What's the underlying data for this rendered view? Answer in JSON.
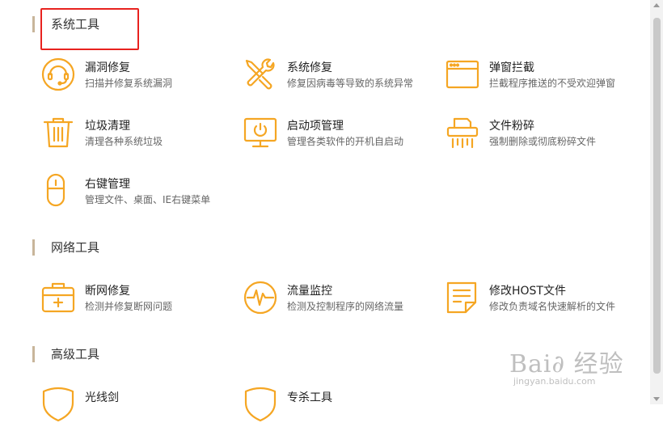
{
  "sections": [
    {
      "title": "系统工具"
    },
    {
      "title": "网络工具"
    },
    {
      "title": "高级工具"
    }
  ],
  "tools": {
    "loophole_repair": {
      "name": "漏洞修复",
      "desc": "扫描并修复系统漏洞",
      "icon": "shield-headset-icon"
    },
    "system_repair": {
      "name": "系统修复",
      "desc": "修复因病毒等导致的系统异常",
      "icon": "wrench-screwdriver-icon"
    },
    "popup_block": {
      "name": "弹窗拦截",
      "desc": "拦截程序推送的不受欢迎弹窗",
      "icon": "window-icon"
    },
    "junk_clean": {
      "name": "垃圾清理",
      "desc": "清理各种系统垃圾",
      "icon": "trash-icon"
    },
    "startup_manage": {
      "name": "启动项管理",
      "desc": "管理各类软件的开机自启动",
      "icon": "monitor-power-icon"
    },
    "file_shred": {
      "name": "文件粉碎",
      "desc": "强制删除或彻底粉碎文件",
      "icon": "shredder-icon"
    },
    "context_menu": {
      "name": "右键管理",
      "desc": "管理文件、桌面、IE右键菜单",
      "icon": "mouse-icon"
    },
    "network_repair": {
      "name": "断网修复",
      "desc": "检测并修复断网问题",
      "icon": "medkit-icon"
    },
    "traffic_monitor": {
      "name": "流量监控",
      "desc": "检测及控制程序的网络流量",
      "icon": "pulse-icon"
    },
    "host_edit": {
      "name": "修改HOST文件",
      "desc": "修改负责域名快速解析的文件",
      "icon": "document-icon"
    },
    "adv_tool_1": {
      "name": "光线剑",
      "desc": "",
      "icon": "shield-icon"
    },
    "adv_tool_2": {
      "name": "专杀工具",
      "desc": "",
      "icon": "shield-icon"
    }
  },
  "watermark": {
    "main": "Bai∂ 经验",
    "sub": "jingyan.baidu.com"
  },
  "colors": {
    "accent": "#f5a623",
    "highlight": "#e8221f",
    "section_bar": "#c8b59a"
  }
}
